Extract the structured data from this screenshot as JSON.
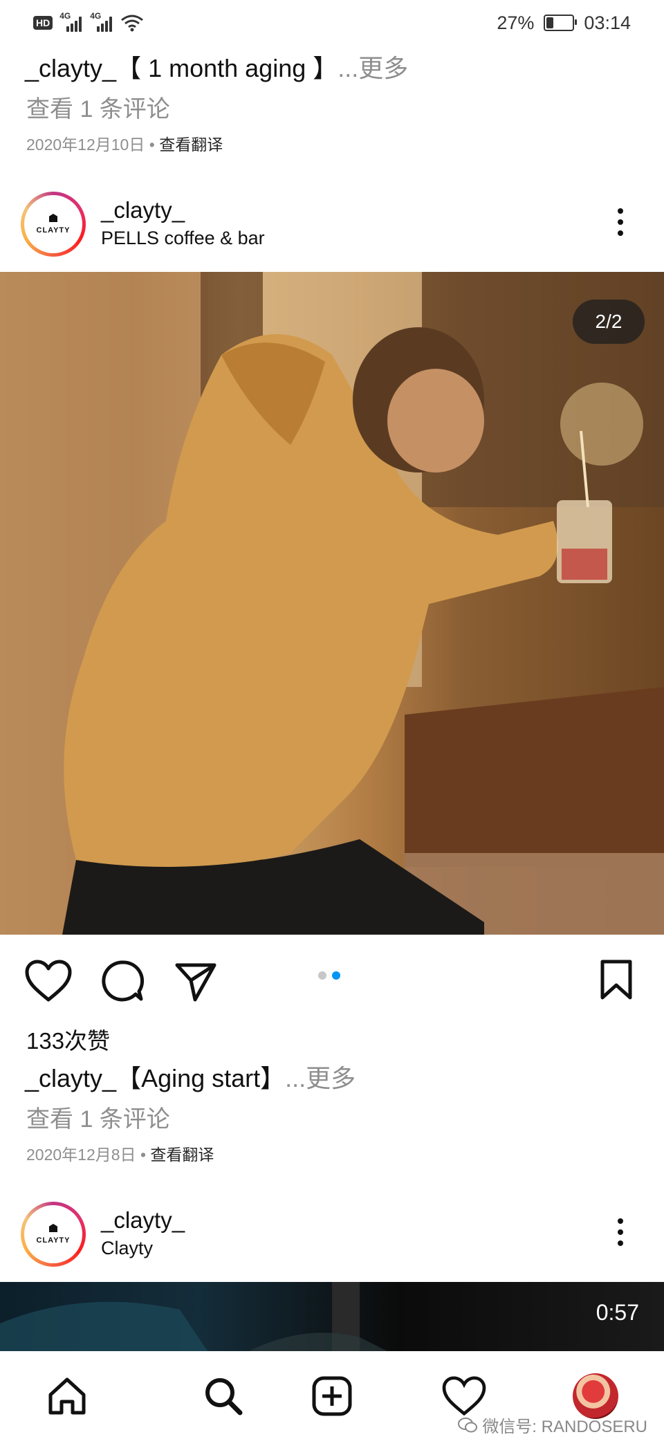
{
  "status_bar": {
    "hd": "HD",
    "network1": "4G",
    "network2": "4G",
    "battery_percent": "27%",
    "battery_level": 0.27,
    "time": "03:14"
  },
  "prev_post": {
    "username": "_clayty_",
    "caption": "【 1 month aging 】",
    "more": "...更多",
    "view_comments": "查看 1 条评论",
    "date": "2020年12月10日",
    "separator": "•",
    "translate": "查看翻译"
  },
  "post": {
    "avatar_logo": "CLAYTY",
    "username": "_clayty_",
    "location": "PELLS coffee & bar",
    "counter": "2/2",
    "carousel_total": 2,
    "carousel_active": 2,
    "likes": "133次赞",
    "caption_user": "_clayty_",
    "caption": "【Aging start】",
    "more": "...更多",
    "view_comments": "查看 1 条评论",
    "date": "2020年12月8日",
    "separator": "•",
    "translate": "查看翻译"
  },
  "next_post": {
    "avatar_logo": "CLAYTY",
    "username": "_clayty_",
    "location": "Clayty",
    "duration": "0:57"
  },
  "bottom_nav": {
    "items": [
      "home-icon",
      "search-icon",
      "add-post-icon",
      "activity-heart-icon",
      "profile-avatar"
    ]
  },
  "watermark": {
    "text": "微信号: RANDOSERU"
  },
  "colors": {
    "secondary_text": "#8e8e8e",
    "active_dot": "#0095f6",
    "inactive_dot": "#c7c7c7",
    "avatar_ring": "#c13584"
  }
}
